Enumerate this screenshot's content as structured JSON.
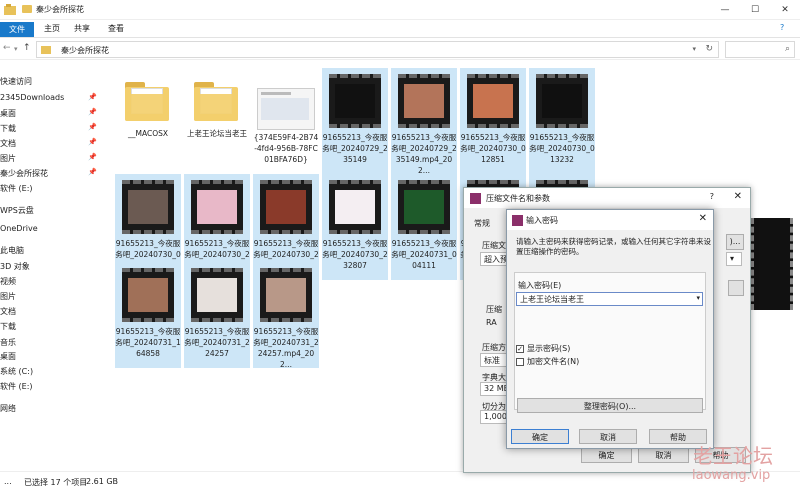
{
  "window": {
    "title": "秦少会所探花",
    "path": "秦少会所探花"
  },
  "ribbon": {
    "tabs": [
      "文件",
      "主页",
      "共享",
      "查看"
    ]
  },
  "nav": [
    {
      "label": "快速访问",
      "pin": false
    },
    {
      "label": "2345Downloads",
      "pin": true
    },
    {
      "label": "桌面",
      "pin": true
    },
    {
      "label": "下载",
      "pin": true
    },
    {
      "label": "文档",
      "pin": true
    },
    {
      "label": "图片",
      "pin": true
    },
    {
      "label": "秦少会所探花",
      "pin": true
    },
    {
      "label": "软件 (E:)",
      "pin": false
    },
    {
      "label": "WPS云盘",
      "pin": false
    },
    {
      "label": "OneDrive",
      "pin": false
    },
    {
      "label": "此电脑",
      "pin": false
    },
    {
      "label": "3D 对象",
      "pin": false
    },
    {
      "label": "视频",
      "pin": false
    },
    {
      "label": "图片",
      "pin": false
    },
    {
      "label": "文档",
      "pin": false
    },
    {
      "label": "下载",
      "pin": false
    },
    {
      "label": "音乐",
      "pin": false
    },
    {
      "label": "桌面",
      "pin": false
    },
    {
      "label": "系统 (C:)",
      "pin": false
    },
    {
      "label": "软件 (E:)",
      "pin": false
    },
    {
      "label": "网络",
      "pin": false
    }
  ],
  "files": [
    {
      "label": "__MACOSX",
      "kind": "folder"
    },
    {
      "label": "上老王论坛当老王",
      "kind": "folder"
    },
    {
      "label": "{374E59F4-2B74-4fd4-956B-78FC01BFA76D}",
      "kind": "image"
    },
    {
      "label": "91655213_今夜服务吧_20240729_235149",
      "kind": "video",
      "color": "#111111"
    },
    {
      "label": "91655213_今夜服务吧_20240729_235149.mp4_202...",
      "kind": "video",
      "color": "#b3745a"
    },
    {
      "label": "91655213_今夜服务吧_20240730_012851",
      "kind": "video",
      "color": "#c8734f"
    },
    {
      "label": "91655213_今夜服务吧_20240730_013232",
      "kind": "video",
      "color": "#101010"
    },
    {
      "label": "91655213_今夜服务吧_20240730_021422",
      "kind": "video",
      "color": "#6b5a52"
    },
    {
      "label": "91655213_今夜服务吧_20240730_223946",
      "kind": "video",
      "color": "#e8b8c8"
    },
    {
      "label": "91655213_今夜服务吧_20240730_230832",
      "kind": "video",
      "color": "#8a3a2a"
    },
    {
      "label": "91655213_今夜服务吧_20240730_232807",
      "kind": "video",
      "color": "#f4eef2"
    },
    {
      "label": "91655213_今夜服务吧_20240731_004111",
      "kind": "video",
      "color": "#1e5a2a"
    },
    {
      "label": "91655213_今夜服务吧_20240731_004111.mp4_202...",
      "kind": "video",
      "color": "#c9a08a"
    },
    {
      "label": "91655213_今夜服务吧_20240731_015025",
      "kind": "video",
      "color": "#d8a890"
    },
    {
      "label": "91655213_今夜服务吧_20240731_164858",
      "kind": "video",
      "color": "#a07058"
    },
    {
      "label": "91655213_今夜服务吧_20240731_224257",
      "kind": "video",
      "color": "#e6e0dc"
    },
    {
      "label": "91655213_今夜服务吧_20240731_224257.mp4_202...",
      "kind": "video",
      "color": "#b89888"
    }
  ],
  "status": {
    "count": "...",
    "selected": "已选择 17 个项目",
    "size": "2.61 GB"
  },
  "compress_dialog": {
    "title": "压缩文件名和参数",
    "q": "?",
    "close": "✕",
    "tab": "常规",
    "labels": [
      "压缩文",
      "超入预",
      "压缩",
      "RA",
      "压缩方",
      "标准",
      "字典大",
      "32 MB",
      "切分为",
      "1,000"
    ],
    "ok": "确定",
    "cancel": "取消",
    "help": "帮助"
  },
  "password_dialog": {
    "title": "输入密码",
    "close": "✕",
    "desc": "请输入主密码来获得密码记录，或输入任何其它字符串来设置压缩操作的密码。",
    "pw_label": "输入密码(E)",
    "pw_value": "上老王论坛当老王",
    "show_pw": "显示密码(S)",
    "encrypt_names": "加密文件名(N)",
    "organize": "整理密码(O)...",
    "ok": "确定",
    "cancel": "取消",
    "help": "帮助"
  },
  "watermark": {
    "line1": "老王论坛",
    "line2": "laowang.vip"
  }
}
